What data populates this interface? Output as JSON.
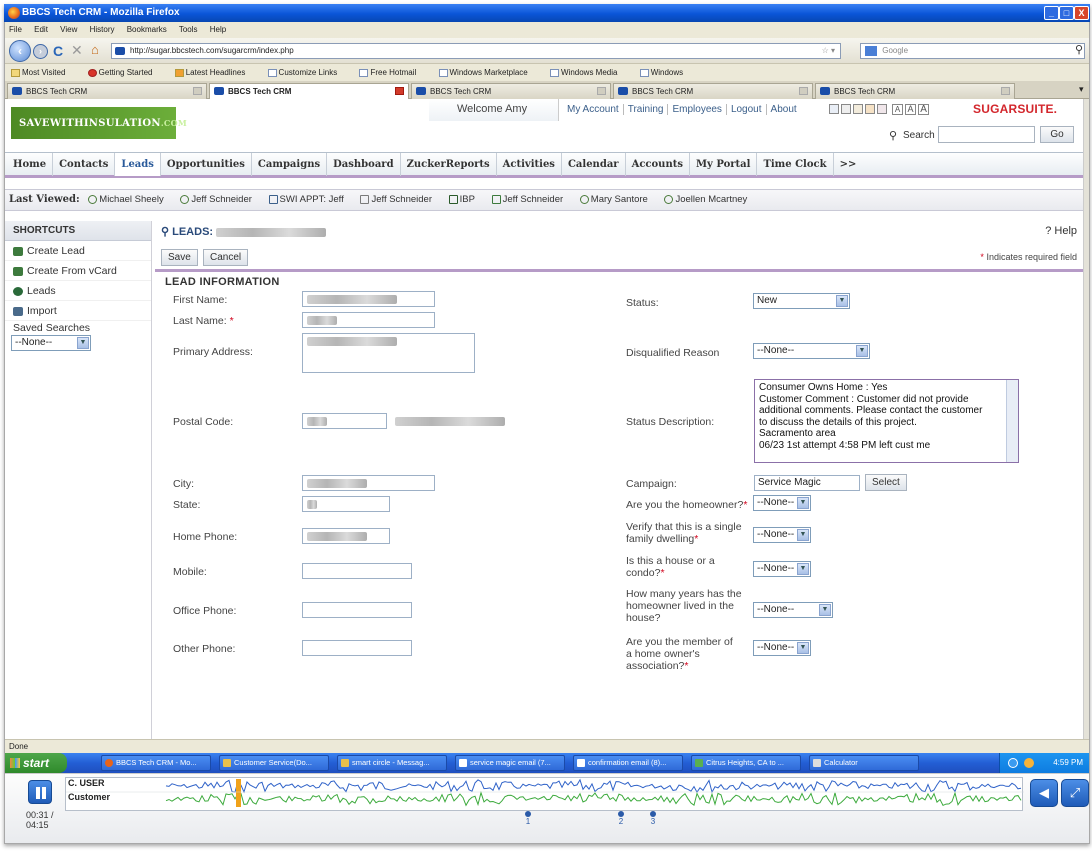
{
  "window": {
    "title": "BBCS Tech CRM - Mozilla Firefox",
    "min_btn": "_",
    "max_btn": "□",
    "close_btn": "X"
  },
  "menu": [
    "File",
    "Edit",
    "View",
    "History",
    "Bookmarks",
    "Tools",
    "Help"
  ],
  "nav": {
    "back_icon": "back-arrow-icon",
    "url": "http://sugar.bbcstech.com/sugarcrm/index.php",
    "search_placeholder": "Google"
  },
  "bookmarks": [
    "Most Visited",
    "Getting Started",
    "Latest Headlines",
    "Customize Links",
    "Free Hotmail",
    "Windows Marketplace",
    "Windows Media",
    "Windows"
  ],
  "browser_tabs": [
    {
      "label": "BBCS Tech CRM",
      "active": false
    },
    {
      "label": "BBCS Tech CRM",
      "active": true
    },
    {
      "label": "BBCS Tech CRM",
      "active": false
    },
    {
      "label": "BBCS Tech CRM",
      "active": false
    },
    {
      "label": "BBCS Tech CRM",
      "active": false
    }
  ],
  "header": {
    "logo": "SAVEWITHINSULATION",
    "logo_suffix": ".COM",
    "welcome": "Welcome Amy",
    "links": [
      "My Account",
      "Training",
      "Employees",
      "Logout",
      "About"
    ],
    "font_size_labels": [
      "A",
      "A",
      "A"
    ],
    "brand": "SUGARSUITE.",
    "search_label": "Search",
    "go": "Go"
  },
  "module_tabs": [
    "Home",
    "Contacts",
    "Leads",
    "Opportunities",
    "Campaigns",
    "Dashboard",
    "ZuckerReports",
    "Activities",
    "Calendar",
    "Accounts",
    "My Portal",
    "Time Clock",
    ">>"
  ],
  "active_tab": "Leads",
  "last_viewed": {
    "label": "Last Viewed:",
    "items": [
      "Michael Sheely",
      "Jeff Schneider",
      "SWI APPT: Jeff",
      "Jeff Schneider",
      "IBP",
      "Jeff Schneider",
      "Mary Santore",
      "Joellen Mcartney"
    ]
  },
  "shortcuts": {
    "title": "SHORTCUTS",
    "items": [
      "Create Lead",
      "Create From vCard",
      "Leads",
      "Import"
    ],
    "saved_searches_label": "Saved Searches",
    "saved_searches_value": "--None--"
  },
  "content": {
    "breadcrumb": "LEADS:",
    "help": "? Help",
    "save": "Save",
    "cancel": "Cancel",
    "required_note": "Indicates required field",
    "section_title": "LEAD INFORMATION"
  },
  "form_left": {
    "first_name": "First Name:",
    "last_name": "Last Name:",
    "primary_address": "Primary Address:",
    "postal_code": "Postal Code:",
    "city": "City:",
    "state": "State:",
    "home_phone": "Home Phone:",
    "mobile": "Mobile:",
    "office_phone": "Office Phone:",
    "other_phone": "Other Phone:"
  },
  "form_right": {
    "status_label": "Status:",
    "status_value": "New",
    "disq_label": "Disqualified Reason",
    "disq_value": "--None--",
    "status_desc_label": "Status Description:",
    "status_desc_lines": [
      "Consumer Owns Home : Yes",
      "Customer Comment  : Customer did not provide",
      "additional comments.  Please contact the customer",
      "to discuss the details of this project.",
      "Sacramento area",
      "06/23 1st attempt 4:58 PM left cust me"
    ],
    "campaign_label": "Campaign:",
    "campaign_value": "Service Magic",
    "select_btn": "Select",
    "homeowner_label": "Are you the homeowner?",
    "homeowner_value": "--None--",
    "single_family_label": "Verify that this is a single family dwelling",
    "single_family_value": "--None--",
    "house_condo_label": "Is this a house or a condo?",
    "house_condo_value": "--None--",
    "years_label": "How many years has the homeowner lived in the house?",
    "years_value": "--None--",
    "hoa_label": "Are you the member of a home owner's association?",
    "hoa_value": "--None--"
  },
  "statusbar": "Done",
  "taskbar": {
    "start": "start",
    "tasks": [
      "BBCS Tech CRM - Mo...",
      "Customer Service(Do...",
      "smart circle - Messag...",
      "service magic email (7...",
      "confirmation email (8)...",
      "Citrus Heights, CA to ...",
      "Calculator"
    ],
    "clock": "4:59 PM"
  },
  "player": {
    "track_user": "C. USER",
    "track_customer": "Customer",
    "time": "00:31 /",
    "duration": "04:15",
    "markers": [
      "1",
      "2",
      "3"
    ]
  }
}
